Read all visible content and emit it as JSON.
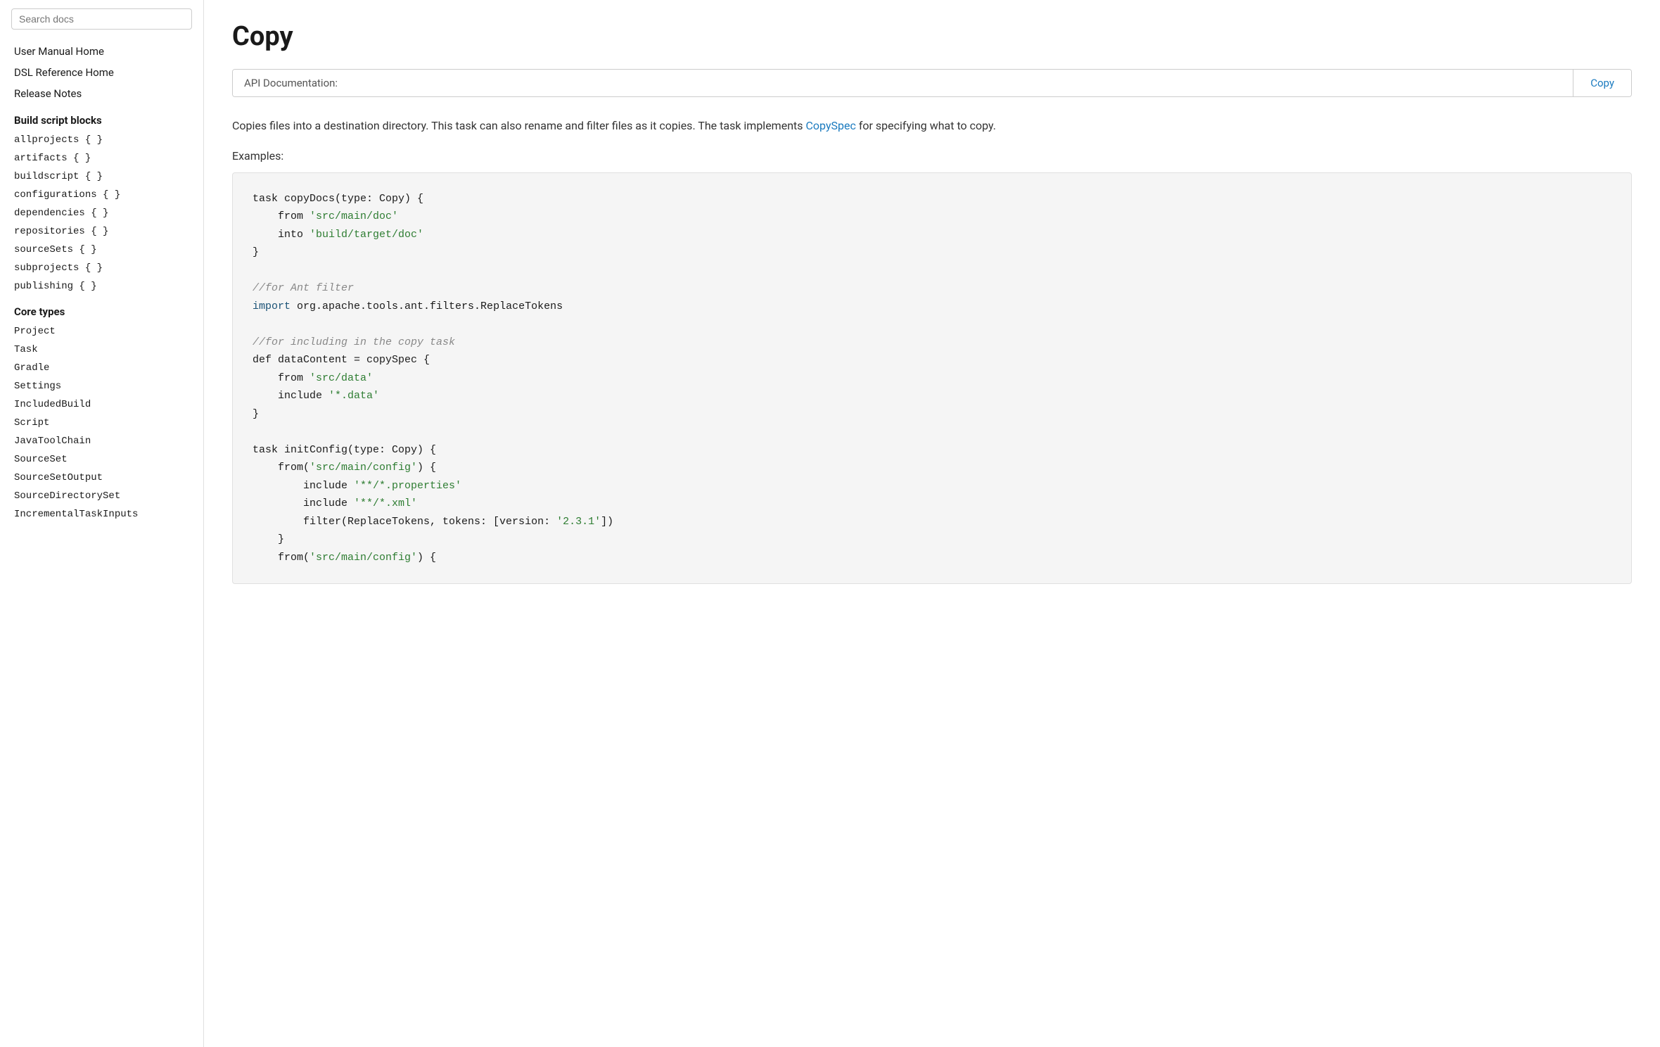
{
  "sidebar": {
    "search_placeholder": "Search docs",
    "nav_items": [
      {
        "label": "User Manual Home",
        "id": "user-manual-home"
      },
      {
        "label": "DSL Reference Home",
        "id": "dsl-reference-home"
      },
      {
        "label": "Release Notes",
        "id": "release-notes"
      }
    ],
    "sections": [
      {
        "title": "Build script blocks",
        "id": "build-script-blocks",
        "items": [
          "allprojects { }",
          "artifacts { }",
          "buildscript { }",
          "configurations { }",
          "dependencies { }",
          "repositories { }",
          "sourceSets { }",
          "subprojects { }",
          "publishing { }"
        ]
      },
      {
        "title": "Core types",
        "id": "core-types",
        "items": [
          "Project",
          "Task",
          "Gradle",
          "Settings",
          "IncludedBuild",
          "Script",
          "JavaToolChain",
          "SourceSet",
          "SourceSetOutput",
          "SourceDirectorySet",
          "IncrementalTaskInputs"
        ]
      }
    ]
  },
  "main": {
    "page_title": "Copy",
    "api_doc_label": "API Documentation:",
    "api_doc_link": "Copy",
    "description": "Copies files into a destination directory. This task can also rename and filter files as it copies. The task implements",
    "copy_spec_link": "CopySpec",
    "description_suffix": "for specifying what to copy.",
    "examples_label": "Examples:",
    "code_lines": [
      {
        "type": "default",
        "text": "task copyDocs(type: Copy) {"
      },
      {
        "type": "indent1",
        "text": "from ",
        "string": "'src/main/doc'"
      },
      {
        "type": "indent1",
        "text": "into ",
        "string": "'build/target/doc'"
      },
      {
        "type": "default",
        "text": "}"
      },
      {
        "type": "blank"
      },
      {
        "type": "comment",
        "text": "//for Ant filter"
      },
      {
        "type": "keyword_import",
        "keyword": "import",
        "text": " org.apache.tools.ant.filters.ReplaceTokens"
      },
      {
        "type": "blank"
      },
      {
        "type": "comment",
        "text": "//for including in the copy task"
      },
      {
        "type": "def",
        "text": "def dataContent = copySpec {"
      },
      {
        "type": "indent1",
        "text": "from ",
        "string": "'src/data'"
      },
      {
        "type": "indent1",
        "text": "include ",
        "string": "'*.data'"
      },
      {
        "type": "default",
        "text": "}"
      },
      {
        "type": "blank"
      },
      {
        "type": "default",
        "text": "task initConfig(type: Copy) {"
      },
      {
        "type": "indent1_from_paren",
        "text": "from(",
        "string": "'src/main/config'",
        "text2": ") {"
      },
      {
        "type": "indent2",
        "text": "include ",
        "string": "'**/*.properties'"
      },
      {
        "type": "indent2",
        "text": "include ",
        "string": "'**/*.xml'"
      },
      {
        "type": "indent2_filter",
        "text": "filter(ReplaceTokens, tokens: [version: ",
        "string": "'2.3.1'",
        "text2": "])"
      },
      {
        "type": "indent1",
        "text": "}"
      },
      {
        "type": "indent1_from_paren",
        "text": "from(",
        "string": "'src/main/config'",
        "text2": ") {"
      }
    ]
  }
}
